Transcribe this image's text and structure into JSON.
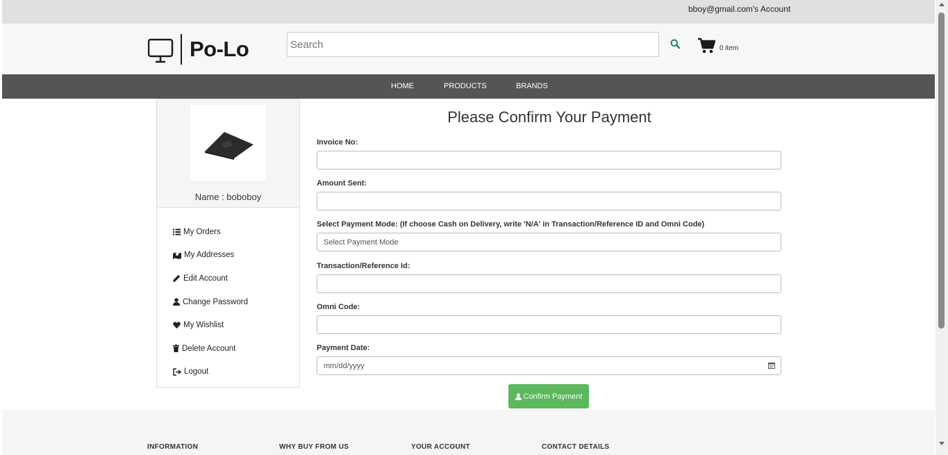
{
  "topbar": {
    "account_text": "bboy@gmail.com's Account"
  },
  "header": {
    "brand": "Po-Lo",
    "search_placeholder": "Search",
    "cart_count": "0 item"
  },
  "nav": {
    "items": [
      "HOME",
      "PRODUCTS",
      "BRANDS"
    ]
  },
  "sidebar": {
    "name": "Name : boboboy",
    "menu": [
      {
        "label": "My Orders",
        "icon": "list-icon"
      },
      {
        "label": "My Addresses",
        "icon": "map-icon"
      },
      {
        "label": "Edit Account",
        "icon": "pencil-icon"
      },
      {
        "label": "Change Password",
        "icon": "user-icon"
      },
      {
        "label": "My Wishlist",
        "icon": "heart-icon"
      },
      {
        "label": "Delete Account",
        "icon": "trash-icon"
      },
      {
        "label": "Logout",
        "icon": "logout-icon"
      }
    ]
  },
  "form": {
    "title": "Please Confirm Your Payment",
    "fields": [
      {
        "label": "Invoice No:",
        "value": ""
      },
      {
        "label": "Amount Sent:",
        "value": ""
      },
      {
        "label": "Select Payment Mode: (If choose Cash on Delivery, write 'N/A' in Transaction/Reference ID and Omni Code)",
        "value": "Select Payment Mode"
      },
      {
        "label": "Transaction/Reference Id:",
        "value": ""
      },
      {
        "label": "Omni Code:",
        "value": ""
      },
      {
        "label": "Payment Date:",
        "value": "mm/dd/yyyy"
      }
    ],
    "submit_label": "Confirm Payment"
  },
  "footer": {
    "columns": [
      "INFORMATION",
      "WHY BUY FROM US",
      "YOUR ACCOUNT",
      "CONTACT DETAILS"
    ]
  },
  "colors": {
    "nav_bg": "#555555",
    "confirm_button": "#5cb85c",
    "search_icon": "#1a8a5a"
  }
}
